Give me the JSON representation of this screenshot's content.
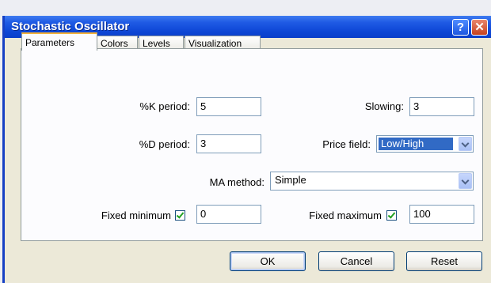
{
  "window": {
    "title": "Stochastic Oscillator",
    "help_label": "?",
    "close_label": "✕"
  },
  "tabs": [
    {
      "label": "Parameters",
      "active": true
    },
    {
      "label": "Colors",
      "active": false
    },
    {
      "label": "Levels",
      "active": false
    },
    {
      "label": "Visualization",
      "active": false
    }
  ],
  "params": {
    "k_period_label": "%K period:",
    "k_period_value": "5",
    "slowing_label": "Slowing:",
    "slowing_value": "3",
    "d_period_label": "%D period:",
    "d_period_value": "3",
    "price_field_label": "Price field:",
    "price_field_value": "Low/High",
    "ma_method_label": "MA method:",
    "ma_method_value": "Simple",
    "fixed_min_label": "Fixed minimum",
    "fixed_min_checked": true,
    "fixed_min_value": "0",
    "fixed_max_label": "Fixed maximum",
    "fixed_max_checked": true,
    "fixed_max_value": "100"
  },
  "buttons": {
    "ok": "OK",
    "cancel": "Cancel",
    "reset": "Reset"
  }
}
